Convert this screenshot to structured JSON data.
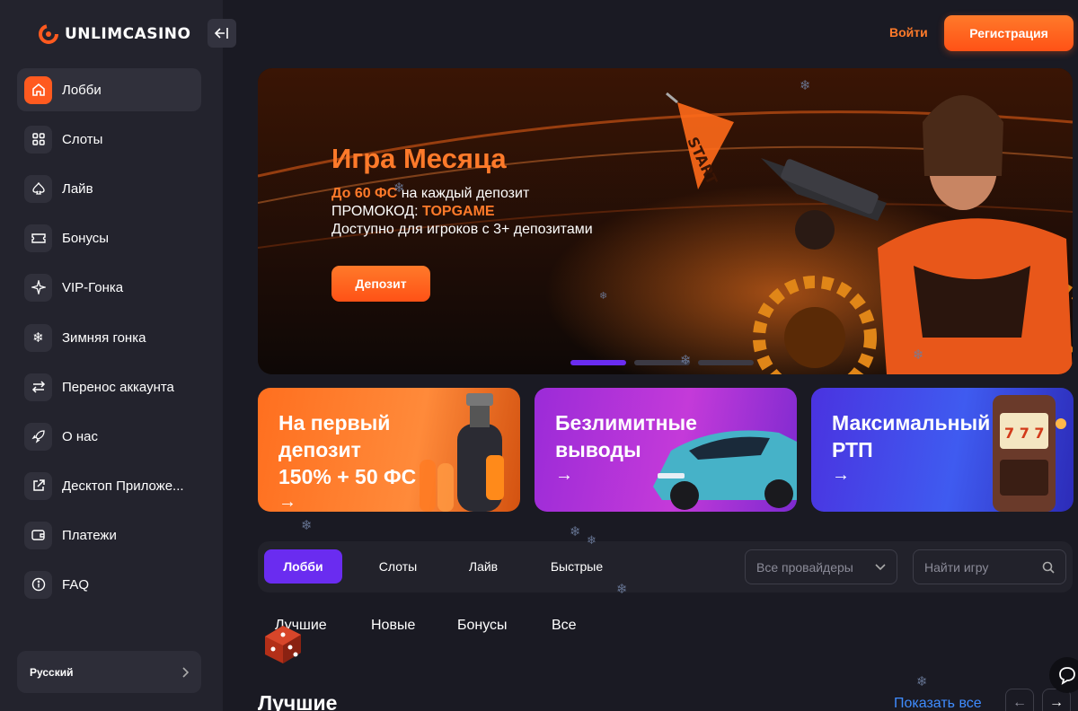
{
  "brand": {
    "name": "UNLIMCASINO"
  },
  "colors": {
    "accent": "#ff5a1f",
    "accent_text": "#ff7a2a",
    "tab_active": "#6a2cf0",
    "link": "#3f8cff"
  },
  "sidebar": {
    "items": [
      {
        "label": "Лобби",
        "icon": "home-icon",
        "active": true
      },
      {
        "label": "Слоты",
        "icon": "grid-icon"
      },
      {
        "label": "Лайв",
        "icon": "spade-icon"
      },
      {
        "label": "Бонусы",
        "icon": "ticket-icon"
      },
      {
        "label": "VIP-Гонка",
        "icon": "sparkle-icon"
      },
      {
        "label": "Зимняя гонка",
        "icon": "snowflake-icon"
      },
      {
        "label": "Перенос аккаунта",
        "icon": "transfer-icon"
      },
      {
        "label": "О нас",
        "icon": "rocket-icon"
      },
      {
        "label": "Десктоп Приложе...",
        "icon": "external-link-icon"
      },
      {
        "label": "Платежи",
        "icon": "wallet-icon"
      },
      {
        "label": "FAQ",
        "icon": "info-icon"
      }
    ],
    "language": "Русский"
  },
  "header": {
    "login": "Войти",
    "register": "Регистрация"
  },
  "hero": {
    "title": "Игра Месяца",
    "line1_highlight": "До 60 ФС",
    "line1_rest": " на каждый депозит",
    "line2_prefix": "ПРОМОКОД: ",
    "line2_code": "TOPGAME",
    "line3": "Доступно для игроков с 3+ депозитами",
    "button": "Депозит",
    "flag_text": "START",
    "slides": 3,
    "active_slide": 1
  },
  "promos": [
    {
      "lines": [
        "На первый",
        "депозит",
        "150% + 50 ФС"
      ],
      "arrow": "→"
    },
    {
      "lines": [
        "Безлимитные",
        "выводы"
      ],
      "arrow": "→"
    },
    {
      "lines": [
        "Максимальный",
        "РТП"
      ],
      "arrow": "→"
    }
  ],
  "filters": {
    "tabs": [
      "Лобби",
      "Слоты",
      "Лайв",
      "Быстрые"
    ],
    "active_tab": "Лобби",
    "provider_select": "Все провайдеры",
    "search_placeholder": "Найти игру"
  },
  "subtabs": [
    "Лучшие",
    "Новые",
    "Бонусы",
    "Все"
  ],
  "section": {
    "title": "Лучшие",
    "show_all": "Показать все"
  }
}
